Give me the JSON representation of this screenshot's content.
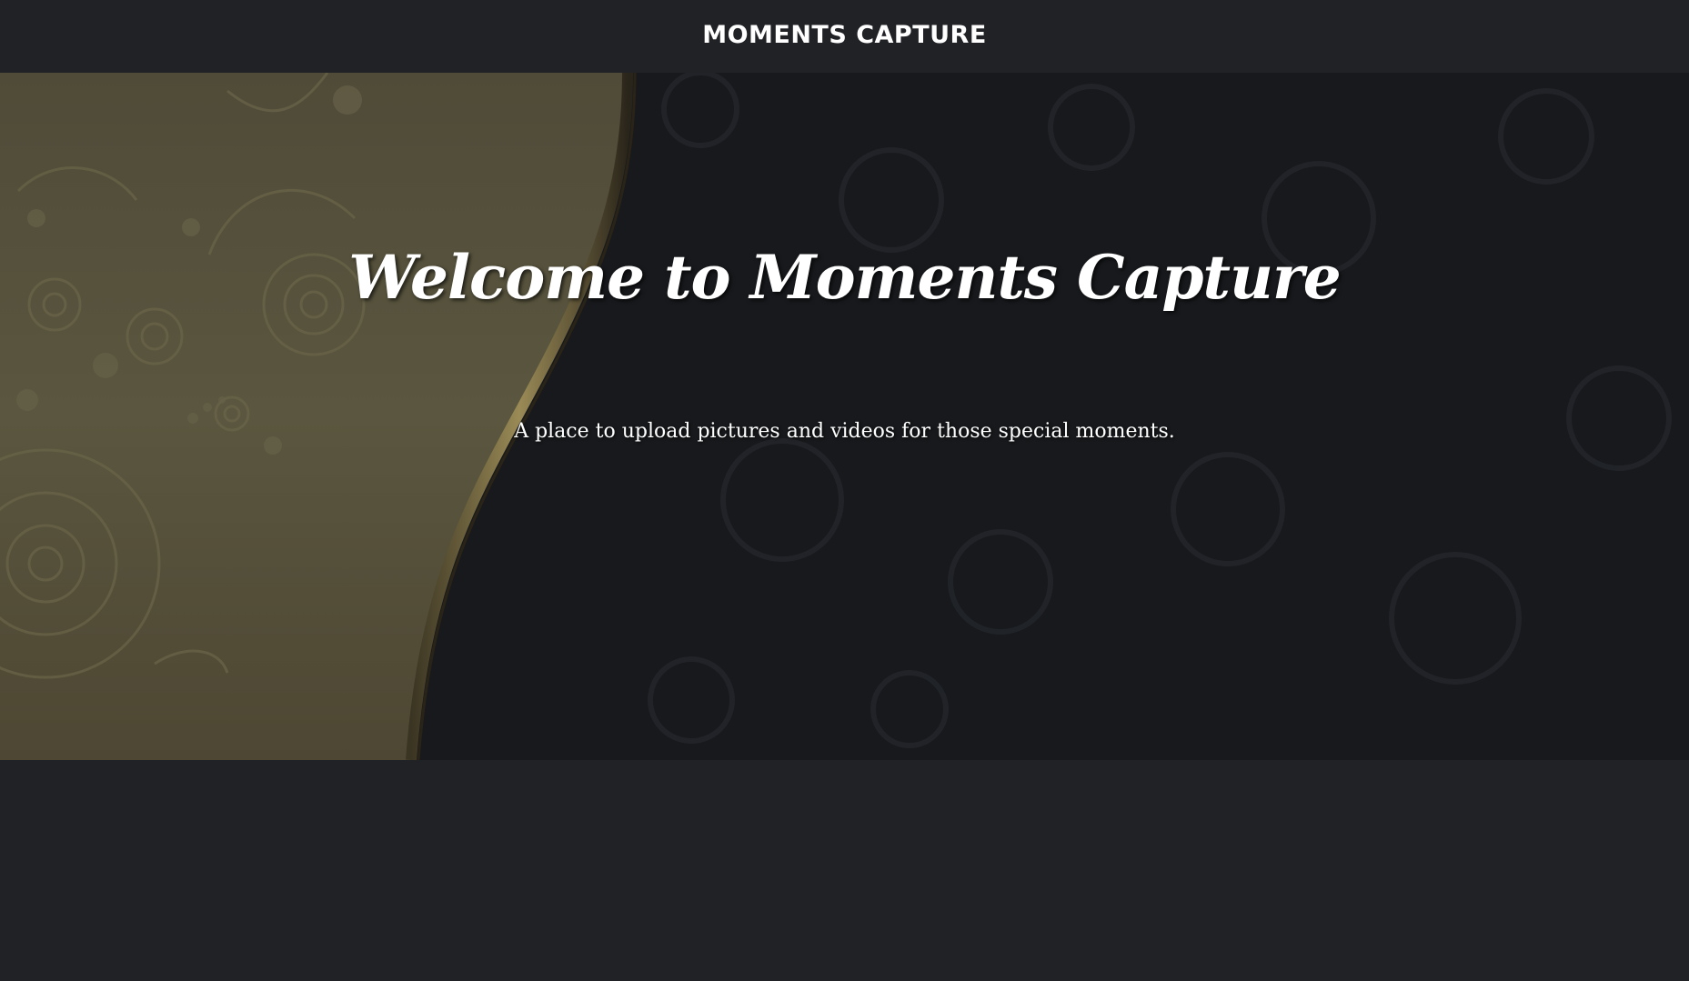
{
  "navbar": {
    "brand": "MOMENTS CAPTURE"
  },
  "hero": {
    "title": "Welcome to Moments Capture",
    "subtitle": "A place to upload pictures and videos for those special moments."
  },
  "colors": {
    "page_background": "#202226",
    "hero_background": "#17191c",
    "gold_panel": "#55513b",
    "gold_edge": "#8a7a4a",
    "text": "#ffffff"
  }
}
